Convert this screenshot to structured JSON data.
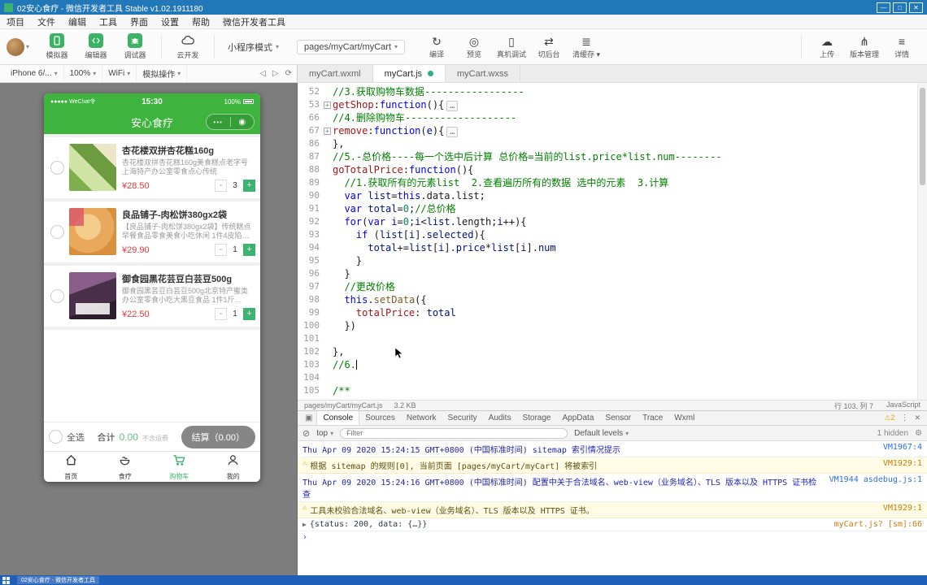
{
  "window": {
    "title": "02安心食疗 - 微信开发者工具 Stable v1.02.1911180",
    "controls": [
      "—",
      "□",
      "✕"
    ]
  },
  "menu": {
    "items": [
      "项目",
      "文件",
      "编辑",
      "工具",
      "界面",
      "设置",
      "帮助",
      "微信开发者工具"
    ]
  },
  "toolbar": {
    "big_buttons": [
      {
        "label": "模拟器"
      },
      {
        "label": "编辑器"
      },
      {
        "label": "调试器"
      },
      {
        "label": "云开发"
      }
    ],
    "mode_select": "小程序模式",
    "page_select": "pages/myCart/myCart",
    "actions": [
      {
        "label": "编译",
        "glyph": "↻"
      },
      {
        "label": "预览",
        "glyph": "◎"
      },
      {
        "label": "真机调试",
        "glyph": "▯"
      },
      {
        "label": "切后台",
        "glyph": "⇄"
      },
      {
        "label": "清缓存",
        "glyph": "≣",
        "caret": true
      }
    ],
    "right_actions": [
      {
        "label": "上传",
        "glyph": "☁"
      },
      {
        "label": "版本管理",
        "glyph": "⋔"
      },
      {
        "label": "详情",
        "glyph": "≡"
      }
    ]
  },
  "device_bar": {
    "device": "iPhone 6/...",
    "zoom": "100%",
    "network": "WiFi",
    "sim_action": "模拟操作"
  },
  "simulator": {
    "status_bar": {
      "carrier": "●●●●● WeChat令",
      "time": "15:30",
      "battery": "100%"
    },
    "nav": {
      "title": "安心食疗",
      "capsule_dots": "•••",
      "capsule_target": "◉"
    },
    "cart_items": [
      {
        "title": "杏花楼双拼杏花糕160g",
        "desc": "杏花楼双拼杏花糕160g美食糕点老字号上海特产办公室零食点心传统",
        "price": "¥28.50",
        "qty": "3",
        "minus": "-",
        "plus": "+",
        "img_style": "img-cake"
      },
      {
        "title": "良品铺子-肉松饼380gx2袋",
        "desc": "【良品铺子-肉松饼380gx2袋】传统糕点早餐食品零食美食小吃休闲 1件4皮陷…",
        "price": "¥29.90",
        "qty": "1",
        "minus": "-",
        "plus": "+",
        "img_style": "img-pastry"
      },
      {
        "title": "御食园黑花芸豆白芸豆500g",
        "desc": "御食园黑芸豆白芸豆500g北京特产蜜类办公室零食小吃大黑豆食品 1件1斤…",
        "price": "¥22.50",
        "qty": "1",
        "minus": "-",
        "plus": "+",
        "img_style": "img-beans"
      }
    ],
    "footer": {
      "select_all": "全选",
      "total_label": "合计",
      "total_value": "0.00",
      "note": "不含运费",
      "checkout": "结算（0.00）"
    },
    "tabbar": [
      {
        "label": "首页",
        "icon": "home-icon",
        "active": false
      },
      {
        "label": "食疗",
        "icon": "diet-icon",
        "active": false
      },
      {
        "label": "购物车",
        "icon": "cart-icon",
        "active": true
      },
      {
        "label": "我的",
        "icon": "me-icon",
        "active": false
      }
    ]
  },
  "editor": {
    "tabs": [
      {
        "label": "myCart.wxml",
        "active": false,
        "modified": false
      },
      {
        "label": "myCart.js",
        "active": true,
        "modified": true
      },
      {
        "label": "myCart.wxss",
        "active": false,
        "modified": false
      }
    ],
    "lines": [
      {
        "n": 52,
        "seg": [
          [
            "c",
            "//3.获取购物车数据-----------------"
          ]
        ]
      },
      {
        "n": 53,
        "fold": "+",
        "seg": [
          [
            "p",
            "getShop"
          ],
          [
            "pl",
            ":"
          ],
          [
            "k",
            "function"
          ],
          [
            "pl",
            "(){"
          ]
        ],
        "ellipsis": "…"
      },
      {
        "n": 66,
        "seg": [
          [
            "c",
            "//4.删除购物车-------------------"
          ]
        ]
      },
      {
        "n": 67,
        "fold": "+",
        "seg": [
          [
            "p",
            "remove"
          ],
          [
            "pl",
            ":"
          ],
          [
            "k",
            "function"
          ],
          [
            "pl",
            "("
          ],
          [
            "v",
            "e"
          ],
          [
            "pl",
            "){"
          ]
        ],
        "ellipsis": "…"
      },
      {
        "n": 86,
        "seg": [
          [
            "pl",
            "},"
          ]
        ]
      },
      {
        "n": 87,
        "seg": [
          [
            "c",
            "//5.-总价格----每一个选中后计算 总价格=当前的list.price*list.num--------"
          ]
        ]
      },
      {
        "n": 88,
        "seg": [
          [
            "p",
            "goTotalPrice"
          ],
          [
            "pl",
            ":"
          ],
          [
            "k",
            "function"
          ],
          [
            "pl",
            "(){"
          ]
        ]
      },
      {
        "n": 89,
        "seg": [
          [
            "pl",
            "  "
          ],
          [
            "c",
            "//1.获取所有的元素list  2.查看遍历所有的数据 选中的元素  3.计算"
          ]
        ]
      },
      {
        "n": 90,
        "seg": [
          [
            "pl",
            "  "
          ],
          [
            "k",
            "var"
          ],
          [
            "v",
            " list"
          ],
          [
            "pl",
            "="
          ],
          [
            "k",
            "this"
          ],
          [
            "pl",
            ".data.list;"
          ]
        ]
      },
      {
        "n": 91,
        "seg": [
          [
            "pl",
            "  "
          ],
          [
            "k",
            "var"
          ],
          [
            "v",
            " total"
          ],
          [
            "pl",
            "="
          ],
          [
            "n",
            "0"
          ],
          [
            "pl",
            ";"
          ],
          [
            "c",
            "//总价格"
          ]
        ]
      },
      {
        "n": 92,
        "seg": [
          [
            "pl",
            "  "
          ],
          [
            "k",
            "for"
          ],
          [
            "pl",
            "("
          ],
          [
            "k",
            "var"
          ],
          [
            "v",
            " i"
          ],
          [
            "pl",
            "="
          ],
          [
            "n",
            "0"
          ],
          [
            "pl",
            ";"
          ],
          [
            "v",
            "i"
          ],
          [
            "pl",
            "<"
          ],
          [
            "v",
            "list"
          ],
          [
            "pl",
            ".length;"
          ],
          [
            "v",
            "i"
          ],
          [
            "pl",
            "++){"
          ]
        ]
      },
      {
        "n": 93,
        "seg": [
          [
            "pl",
            "    "
          ],
          [
            "k",
            "if"
          ],
          [
            "pl",
            " ("
          ],
          [
            "v",
            "list"
          ],
          [
            "pl",
            "["
          ],
          [
            "v",
            "i"
          ],
          [
            "pl",
            "]."
          ],
          [
            "v",
            "selected"
          ],
          [
            "pl",
            "){"
          ]
        ]
      },
      {
        "n": 94,
        "seg": [
          [
            "pl",
            "      "
          ],
          [
            "v",
            "total"
          ],
          [
            "pl",
            "+="
          ],
          [
            "v",
            "list"
          ],
          [
            "pl",
            "["
          ],
          [
            "v",
            "i"
          ],
          [
            "pl",
            "]."
          ],
          [
            "v",
            "price"
          ],
          [
            "pl",
            "*"
          ],
          [
            "v",
            "list"
          ],
          [
            "pl",
            "["
          ],
          [
            "v",
            "i"
          ],
          [
            "pl",
            "]."
          ],
          [
            "v",
            "num"
          ]
        ]
      },
      {
        "n": 95,
        "seg": [
          [
            "pl",
            "    }"
          ]
        ]
      },
      {
        "n": 96,
        "seg": [
          [
            "pl",
            "  }"
          ]
        ]
      },
      {
        "n": 97,
        "seg": [
          [
            "pl",
            "  "
          ],
          [
            "c",
            "//更改价格"
          ]
        ]
      },
      {
        "n": 98,
        "seg": [
          [
            "pl",
            "  "
          ],
          [
            "k",
            "this"
          ],
          [
            "pl",
            "."
          ],
          [
            "f",
            "setData"
          ],
          [
            "pl",
            "({"
          ]
        ]
      },
      {
        "n": 99,
        "seg": [
          [
            "p",
            "    totalPrice"
          ],
          [
            "pl",
            ": "
          ],
          [
            "v",
            "total"
          ]
        ]
      },
      {
        "n": 100,
        "seg": [
          [
            "pl",
            "  })"
          ]
        ]
      },
      {
        "n": 101,
        "seg": []
      },
      {
        "n": 102,
        "seg": [
          [
            "pl",
            "},"
          ]
        ]
      },
      {
        "n": 103,
        "seg": [
          [
            "c",
            "//6."
          ]
        ],
        "caret": true
      },
      {
        "n": 104,
        "seg": []
      },
      {
        "n": 105,
        "seg": [
          [
            "c",
            "/**"
          ]
        ]
      }
    ],
    "status": {
      "file": "pages/myCart/myCart.js",
      "size": "3.2 KB",
      "position": "行 103, 列 7",
      "language": "JavaScript"
    }
  },
  "devtools": {
    "tabs": [
      "Console",
      "Sources",
      "Network",
      "Security",
      "Audits",
      "Storage",
      "AppData",
      "Sensor",
      "Trace",
      "Wxml"
    ],
    "active_tab": "Console",
    "warn_badge": "2",
    "toolbar": {
      "context": "top",
      "filter_placeholder": "Filter",
      "levels": "Default levels",
      "hidden_note": "1 hidden"
    },
    "messages": [
      {
        "type": "log",
        "text": "Thu Apr 09 2020 15:24:15 GMT+0800 (中国标准时间) sitemap 索引情况提示",
        "source": "VM1967:4"
      },
      {
        "type": "warn",
        "text": "根据 sitemap 的规则[0], 当前页面 [pages/myCart/myCart] 将被索引",
        "source": "VM1929:1"
      },
      {
        "type": "log",
        "text": "Thu Apr 09 2020 15:24:16 GMT+0800 (中国标准时间) 配置中关于合法域名、web-view（业务域名）、TLS 版本以及 HTTPS 证书检查",
        "source": "VM1944 asdebug.js:1"
      },
      {
        "type": "warn",
        "text": "工具未校验合法域名、web-view（业务域名）、TLS 版本以及 HTTPS 证书。",
        "source": "VM1929:1"
      },
      {
        "type": "obj",
        "arrow": "▶",
        "text": "{status: 200, data: {…}}",
        "source": "myCart.js? [sm]:66"
      }
    ],
    "prompt": "›"
  },
  "taskbar": {
    "app_label": "02安心食疗 - 微信开发者工具"
  }
}
